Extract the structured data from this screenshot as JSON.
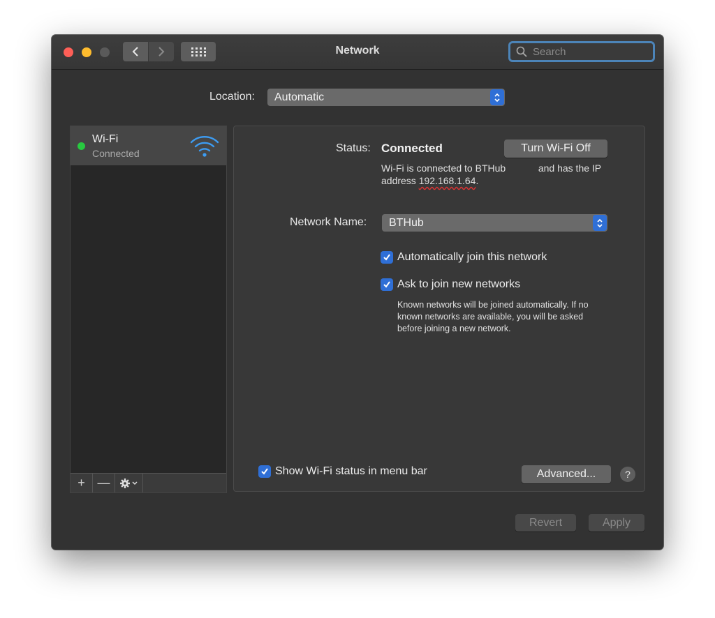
{
  "window": {
    "title": "Network",
    "search_placeholder": "Search"
  },
  "location": {
    "label": "Location:",
    "value": "Automatic"
  },
  "sidebar": {
    "services": [
      {
        "name": "Wi-Fi",
        "status": "Connected",
        "status_color": "#28c940",
        "icon": "wifi-icon"
      }
    ],
    "toolbar": {
      "add": "+",
      "remove": "—"
    }
  },
  "detail": {
    "status_label": "Status:",
    "status_value": "Connected",
    "toggle_button": "Turn Wi-Fi Off",
    "status_desc_pre": "Wi-Fi is connected to BTHub            and has the IP address ",
    "ip_address": "192.168.1.64",
    "status_desc_post": ".",
    "network_name_label": "Network Name:",
    "network_name_value": "BTHub",
    "auto_join_label": "Automatically join this network",
    "auto_join_checked": true,
    "ask_join_label": "Ask to join new networks",
    "ask_join_checked": true,
    "ask_join_desc": "Known networks will be joined automatically. If no known networks are available, you will be asked before joining a new network.",
    "show_status_label": "Show Wi-Fi status in menu bar",
    "show_status_checked": true,
    "advanced_button": "Advanced...",
    "help_button": "?"
  },
  "footer": {
    "revert_button": "Revert",
    "apply_button": "Apply"
  },
  "colors": {
    "accent": "#2f6fd6",
    "close": "#fe5f57",
    "minimize": "#febc2e",
    "connected": "#28c940"
  }
}
